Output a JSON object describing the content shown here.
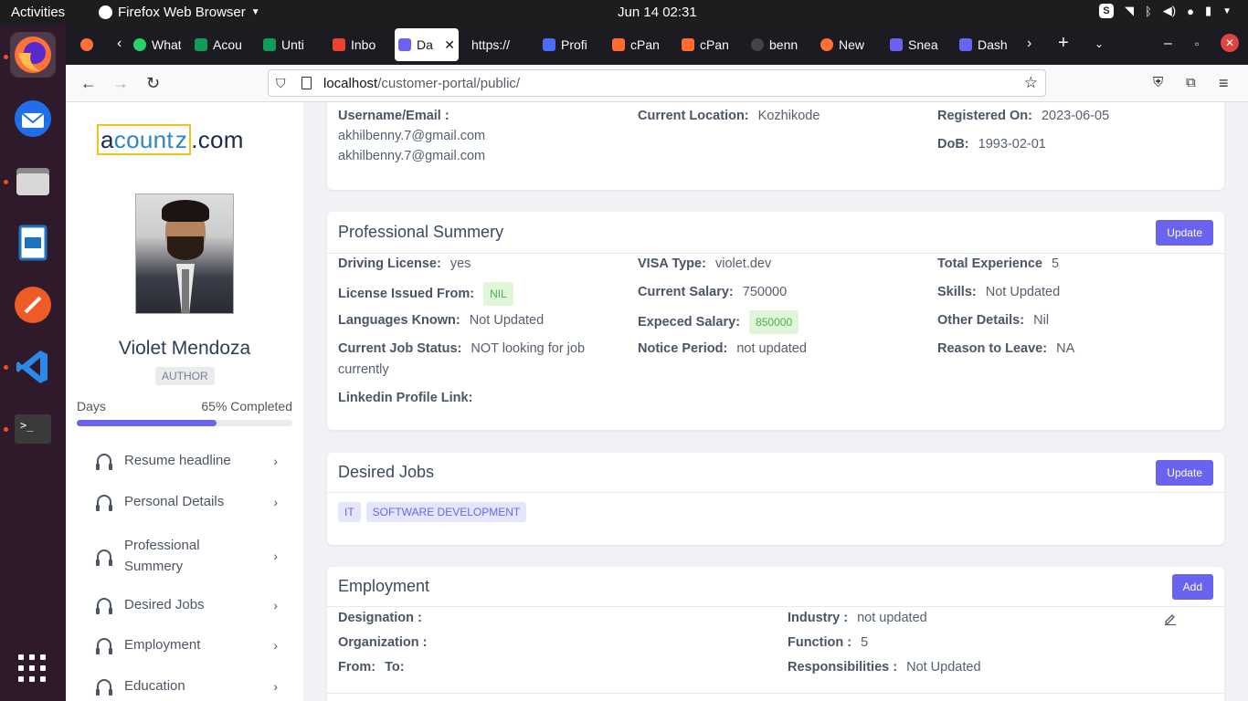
{
  "system": {
    "activities": "Activities",
    "app_menu": "Firefox Web Browser",
    "clock": "Jun 14  02:31"
  },
  "browser": {
    "tabs": [
      "What",
      "Acou",
      "Unti",
      "Inbo",
      "Da",
      "https://",
      "Profi",
      "cPan",
      "cPan",
      "benn",
      "New",
      "Snea",
      "Dash"
    ],
    "url_host": "localhost",
    "url_path": "/customer-portal/public/"
  },
  "sidebar": {
    "logo_a": "a",
    "logo_mid": "count",
    "logo_z": "z",
    "logo_tld": ".com",
    "profile_name": "Violet Mendoza",
    "role": "AUTHOR",
    "days_label": "Days",
    "completion": "65% Completed",
    "progress_percent": 65,
    "menu": [
      {
        "label": "Resume headline"
      },
      {
        "label": "Personal Details"
      },
      {
        "label": "Professional Summery"
      },
      {
        "label": "Desired Jobs"
      },
      {
        "label": "Employment"
      },
      {
        "label": "Education"
      }
    ]
  },
  "personal": {
    "username_label": "Username/Email :",
    "username": "akhilbenny.7@gmail.com",
    "email": "akhilbenny.7@gmail.com",
    "location_label": "Current Location:",
    "location": "Kozhikode",
    "registered_label": "Registered On:",
    "registered": "2023-06-05",
    "dob_label": "DoB:",
    "dob": "1993-02-01"
  },
  "professional": {
    "title": "Professional Summery",
    "update_label": "Update",
    "driving_label": "Driving License:",
    "driving": "yes",
    "license_from_label": "License Issued From:",
    "license_from": "NIL",
    "languages_label": "Languages Known:",
    "languages": "Not Updated",
    "job_status_label": "Current Job Status:",
    "job_status": "NOT looking for job currently",
    "linkedin_label": "Linkedin Profile Link:",
    "visa_label": "VISA Type:",
    "visa": "violet.dev",
    "salary_label": "Current Salary:",
    "salary": "750000",
    "expected_label": "Expeced Salary:",
    "expected": "850000",
    "notice_label": "Notice Period:",
    "notice": "not updated",
    "experience_label": "Total Experience",
    "experience": "5",
    "skills_label": "Skills:",
    "skills": "Not Updated",
    "other_label": "Other Details:",
    "other": "Nil",
    "reason_label": "Reason to Leave:",
    "reason": "NA"
  },
  "desired": {
    "title": "Desired Jobs",
    "update_label": "Update",
    "tags": [
      "IT",
      "SOFTWARE DEVELOPMENT"
    ]
  },
  "employment": {
    "title": "Employment",
    "add_label": "Add",
    "designation_label": "Designation :",
    "organization_label": "Organization :",
    "from_label": "From:",
    "to_label": "To:",
    "industry_label": "Industry :",
    "industry": "not updated",
    "function_label": "Function :",
    "function": "5",
    "responsibilities_label": "Responsibilities :",
    "responsibilities": "Not Updated"
  },
  "colors": {
    "accent": "#6a63f0",
    "chip_green": "#dff7d8",
    "dock": "#2f1a2b"
  }
}
